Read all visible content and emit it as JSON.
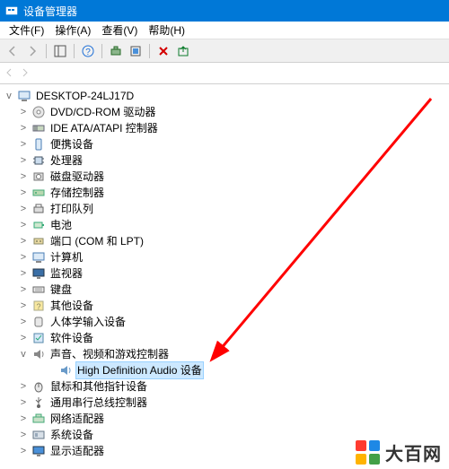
{
  "window": {
    "title": "设备管理器"
  },
  "menu": {
    "file": "文件(F)",
    "action": "操作(A)",
    "view": "查看(V)",
    "help": "帮助(H)"
  },
  "tree": {
    "root": "DESKTOP-24LJ17D",
    "nodes": [
      {
        "icon": "disc",
        "label": "DVD/CD-ROM 驱动器"
      },
      {
        "icon": "ide",
        "label": "IDE ATA/ATAPI 控制器"
      },
      {
        "icon": "portable",
        "label": "便携设备"
      },
      {
        "icon": "cpu",
        "label": "处理器"
      },
      {
        "icon": "disk",
        "label": "磁盘驱动器"
      },
      {
        "icon": "storage",
        "label": "存储控制器"
      },
      {
        "icon": "printq",
        "label": "打印队列"
      },
      {
        "icon": "battery",
        "label": "电池"
      },
      {
        "icon": "port",
        "label": "端口 (COM 和 LPT)"
      },
      {
        "icon": "computer",
        "label": "计算机"
      },
      {
        "icon": "monitor",
        "label": "监视器"
      },
      {
        "icon": "keyboard",
        "label": "键盘"
      },
      {
        "icon": "other",
        "label": "其他设备"
      },
      {
        "icon": "hid",
        "label": "人体学输入设备"
      },
      {
        "icon": "software",
        "label": "软件设备"
      },
      {
        "icon": "sound",
        "label": "声音、视频和游戏控制器",
        "expanded": true,
        "children": [
          {
            "icon": "speaker",
            "label": "High Definition Audio 设备",
            "selected": true
          }
        ]
      },
      {
        "icon": "mouse",
        "label": "鼠标和其他指针设备"
      },
      {
        "icon": "usb",
        "label": "通用串行总线控制器"
      },
      {
        "icon": "network",
        "label": "网络适配器"
      },
      {
        "icon": "system",
        "label": "系统设备"
      },
      {
        "icon": "display",
        "label": "显示适配器"
      }
    ]
  },
  "logo": {
    "text": "大百网"
  }
}
